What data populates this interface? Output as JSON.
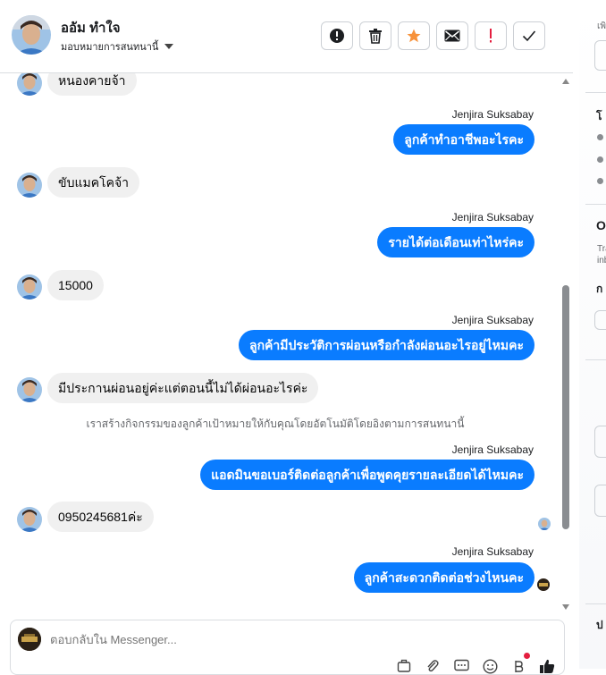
{
  "header": {
    "name": "ออัม ทำใจ",
    "assign_label": "มอบหมายการสนทนานี้",
    "actions": [
      {
        "icon": "alert-circle-icon",
        "label": "report"
      },
      {
        "icon": "trash-icon",
        "label": "delete"
      },
      {
        "icon": "star-icon",
        "label": "star"
      },
      {
        "icon": "mail-icon",
        "label": "mark-unread"
      },
      {
        "icon": "exclamation-icon",
        "label": "flag"
      },
      {
        "icon": "check-icon",
        "label": "done"
      }
    ]
  },
  "messages": {
    "in1": "หนองคายจ้า",
    "sender": "Jenjira Suksabay",
    "out1": "ลูกค้าทำอาชีพอะไรคะ",
    "in2": "ขับแมคโคจ้า",
    "out2": "รายได้ต่อเดือนเท่าไหร่คะ",
    "in3": "15000",
    "out3": "ลูกค้ามีประวัติการผ่อนหรือกำลังผ่อนอะไรอยู่ไหมคะ",
    "in4": "มีประกานผ่อนอยู่ค่ะแต่ตอนนี้ไม่ได้ผ่อนอะไรค่ะ",
    "system_note": "เราสร้างกิจกรรมของลูกค้าเป้าหมายให้กับคุณโดยอัตโนมัติโดยอิงตามการสนทนานี้",
    "out4": "แอดมินขอเบอร์ติดต่อลูกค้าเพื่อพูดคุยรายละเอียดได้ไหมคะ",
    "in5": "0950245681ค่ะ",
    "out5": "ลูกค้าสะดวกติดต่อช่วงไหนคะ"
  },
  "composer": {
    "placeholder": "ตอบกลับใน Messenger..."
  },
  "colors": {
    "outgoing_bubble": "#0a7cff",
    "incoming_bubble": "#f0f0f0",
    "star": "#f7923b",
    "flag": "#e41e3f"
  },
  "side": {
    "t1": "โ",
    "t2": "O",
    "t3": "Tra",
    "t4": "inb",
    "t5": "ก",
    "t6": "ป",
    "t7": "เพิ"
  }
}
